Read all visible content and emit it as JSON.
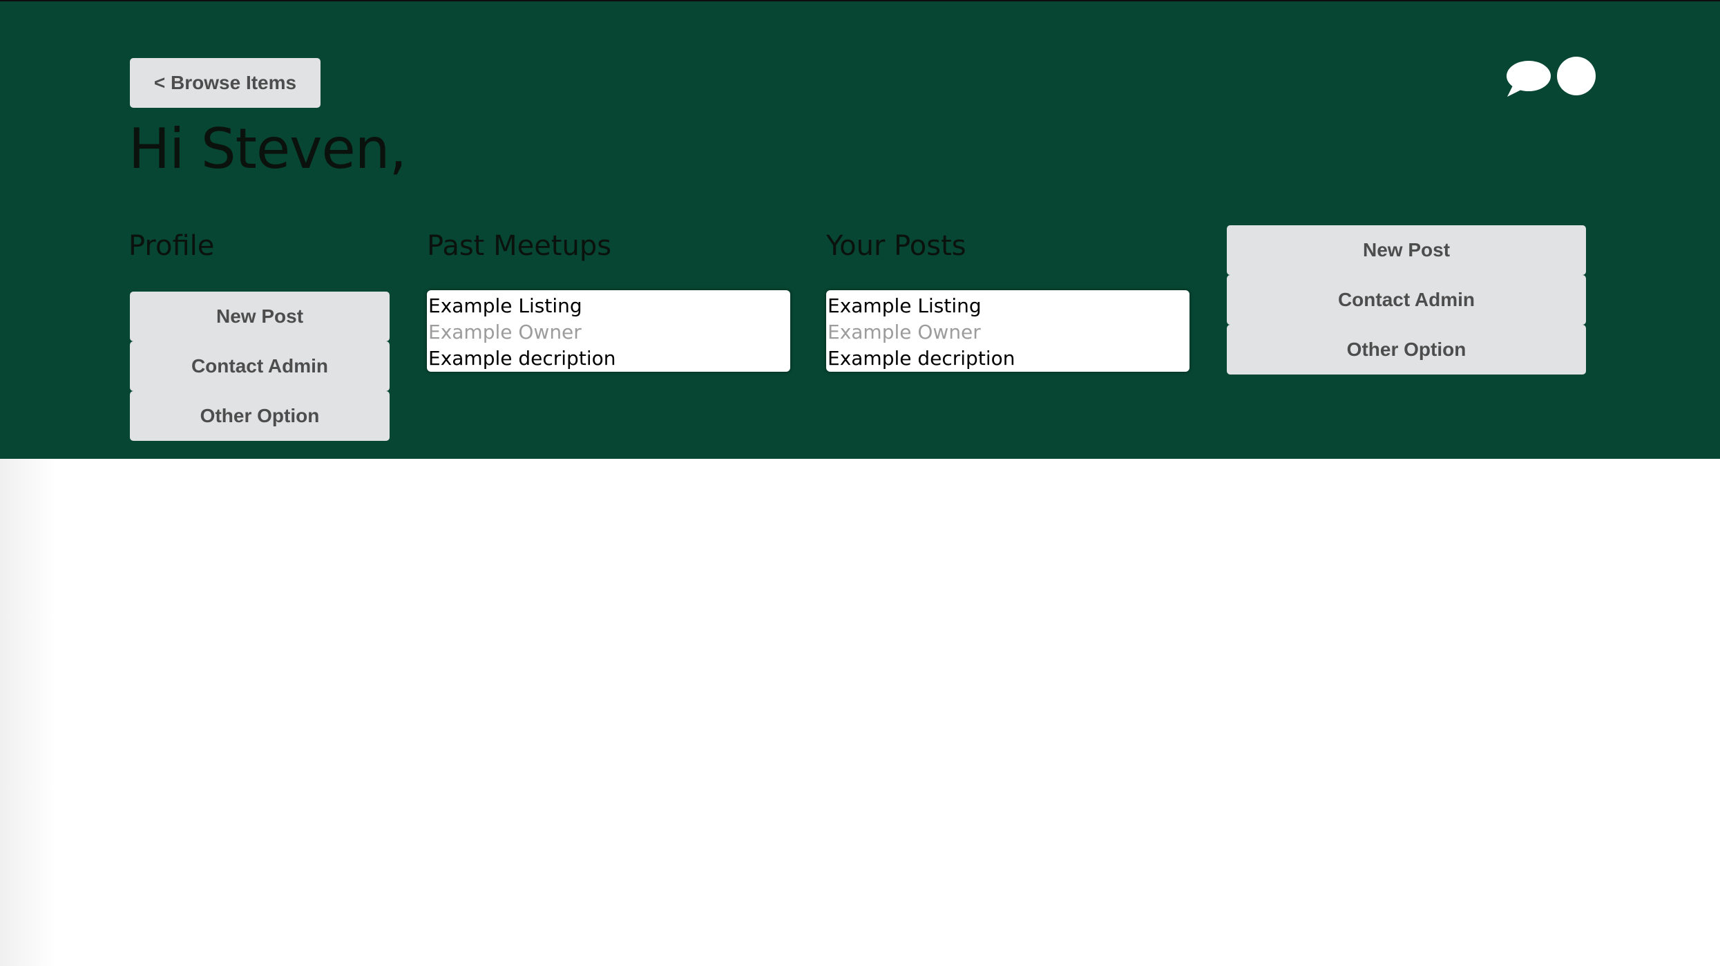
{
  "nav": {
    "browse_label": "< Browse Items"
  },
  "greeting": "Hi Steven,",
  "sections": {
    "profile_title": "Profile",
    "meetups_title": "Past Meetups",
    "posts_title": "Your Posts"
  },
  "profile_menu": {
    "items": [
      {
        "label": "New Post"
      },
      {
        "label": "Contact Admin"
      },
      {
        "label": "Other Option"
      }
    ]
  },
  "meetups": {
    "items": [
      {
        "title": "Example Listing",
        "owner": "Example Owner",
        "description": "Example decription"
      }
    ]
  },
  "posts": {
    "items": [
      {
        "title": "Example Listing",
        "owner": "Example Owner",
        "description": "Example decription"
      }
    ]
  },
  "side_menu": {
    "items": [
      {
        "label": "New Post"
      },
      {
        "label": "Contact Admin"
      },
      {
        "label": "Other Option"
      }
    ]
  },
  "icons": {
    "chat": "chat-bubble-icon",
    "avatar": "user-avatar-icon"
  },
  "colors": {
    "header_bg": "#074632",
    "button_bg": "#e1e2e3",
    "button_text": "#4d4d4d",
    "owner_text": "#9c9c9c",
    "heading_text": "#0b120e"
  }
}
